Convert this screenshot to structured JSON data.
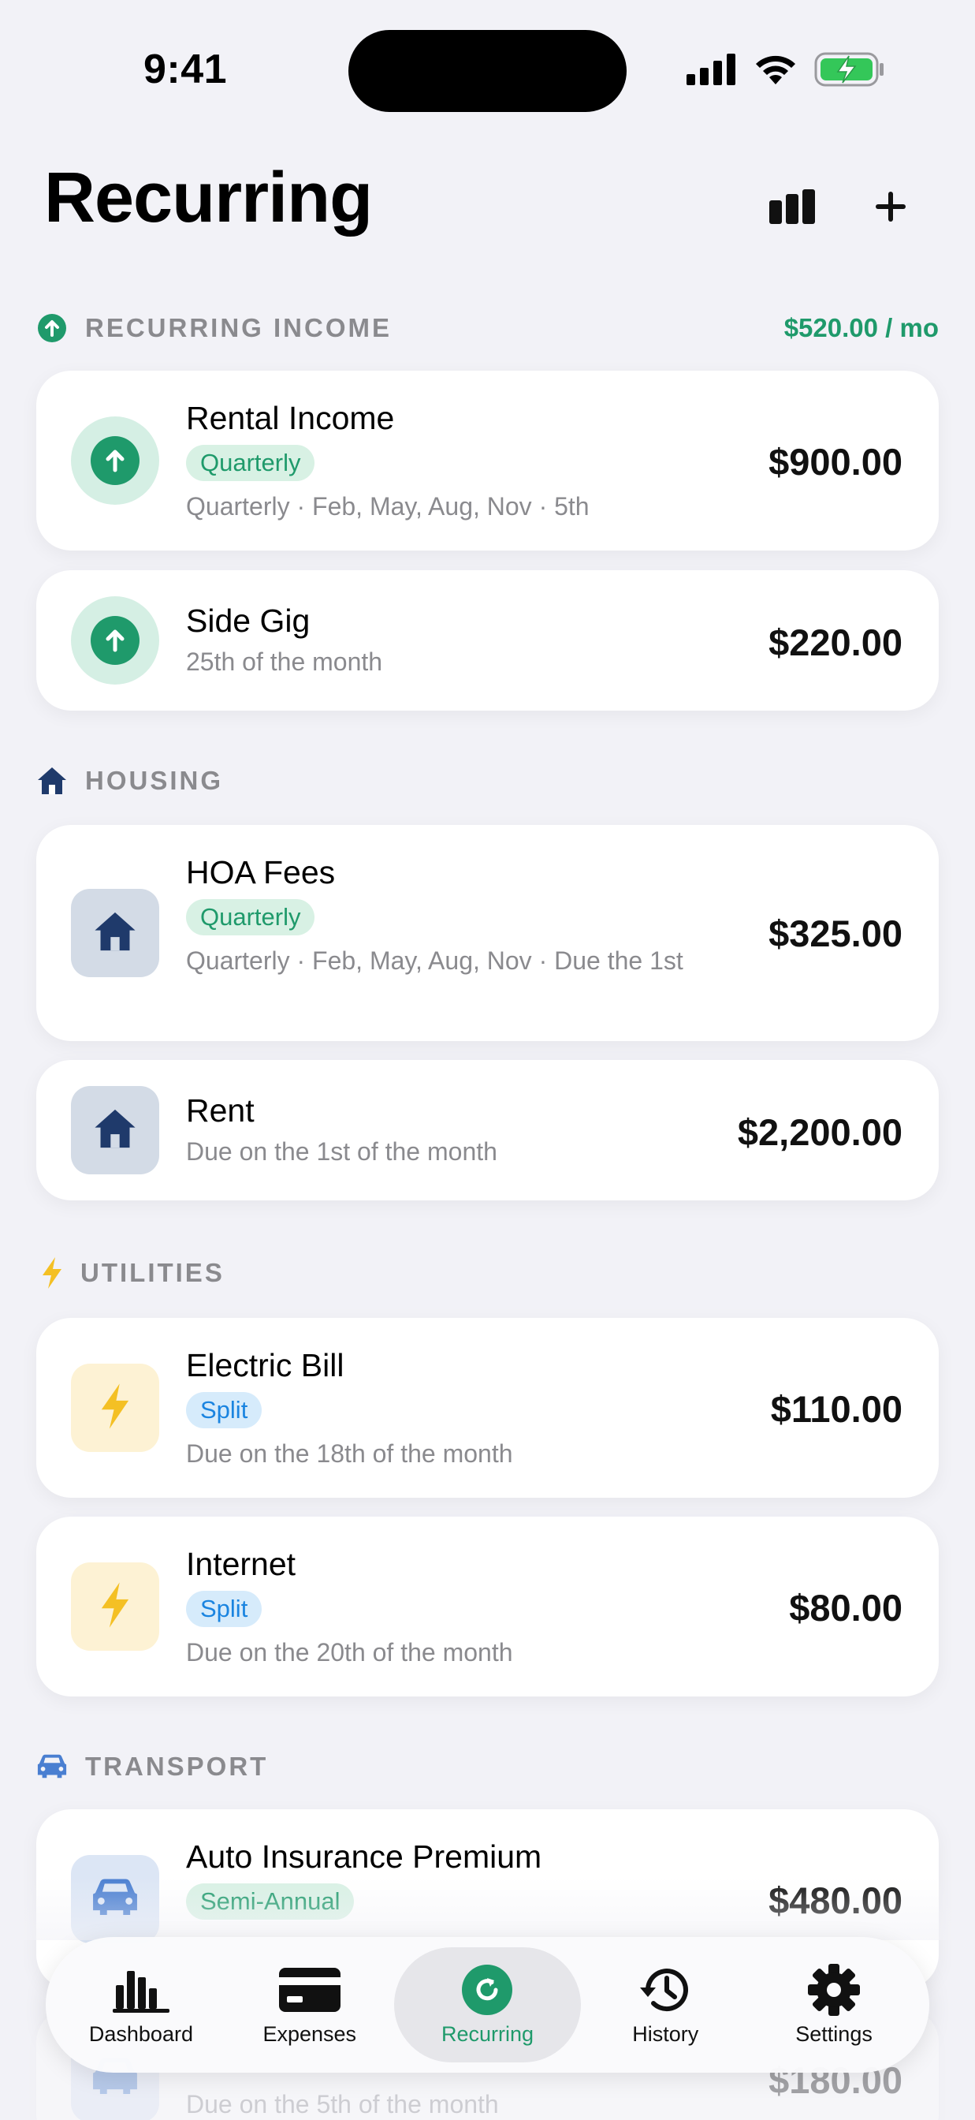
{
  "status_bar": {
    "time": "9:41"
  },
  "header": {
    "title": "Recurring"
  },
  "sections": {
    "income": {
      "label": "RECURRING INCOME",
      "total": "$520.00 / mo",
      "items": [
        {
          "name": "Rental Income",
          "badge": "Quarterly",
          "sub": "Quarterly · Feb, May, Aug, Nov · 5th",
          "amount": "$900.00"
        },
        {
          "name": "Side Gig",
          "sub": "25th of the month",
          "amount": "$220.00"
        }
      ]
    },
    "housing": {
      "label": "HOUSING",
      "items": [
        {
          "name": "HOA Fees",
          "badge": "Quarterly",
          "sub": "Quarterly · Feb, May, Aug, Nov · Due the 1st",
          "amount": "$325.00"
        },
        {
          "name": "Rent",
          "sub": "Due on the 1st of the month",
          "amount": "$2,200.00"
        }
      ]
    },
    "utilities": {
      "label": "UTILITIES",
      "items": [
        {
          "name": "Electric Bill",
          "badge": "Split",
          "sub": "Due on the 18th of the month",
          "amount": "$110.00"
        },
        {
          "name": "Internet",
          "badge": "Split",
          "sub": "Due on the 20th of the month",
          "amount": "$80.00"
        }
      ]
    },
    "transport": {
      "label": "TRANSPORT",
      "items": [
        {
          "name": "Auto Insurance Premium",
          "badge": "Semi-Annual",
          "amount": "$480.00"
        },
        {
          "sub": "Due on the 5th of the month",
          "amount": "$180.00"
        }
      ]
    }
  },
  "tabbar": {
    "tabs": [
      {
        "label": "Dashboard",
        "icon": "bar-chart-icon"
      },
      {
        "label": "Expenses",
        "icon": "credit-card-icon"
      },
      {
        "label": "Recurring",
        "icon": "recurring-icon",
        "active": true
      },
      {
        "label": "History",
        "icon": "history-icon"
      },
      {
        "label": "Settings",
        "icon": "gear-icon"
      }
    ]
  },
  "colors": {
    "accent_green": "#1f9a6b",
    "split_blue": "#1a84e0",
    "housing_navy": "#1f3a6b",
    "utilities_yellow": "#f4c024",
    "transport_blue": "#4a7fd1",
    "background": "#f2f2f7"
  }
}
